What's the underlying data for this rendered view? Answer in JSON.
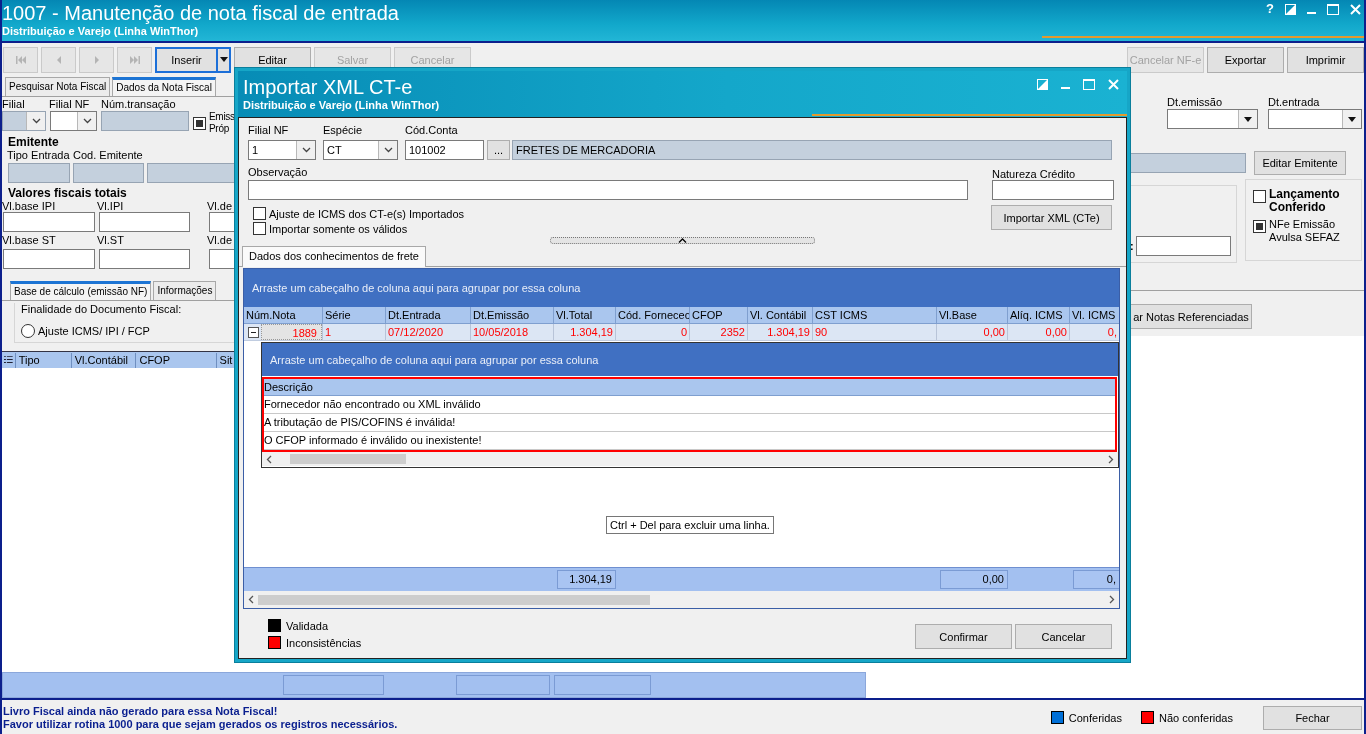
{
  "window": {
    "title": "1007 - Manutenção de nota fiscal de entrada",
    "subtitle": "Distribuição e Varejo (Linha WinThor)",
    "help": "?"
  },
  "toolbar": {
    "nav_buttons": [
      {
        "kind": "first",
        "disabled": true
      },
      {
        "kind": "prev",
        "disabled": true
      },
      {
        "kind": "next",
        "disabled": true
      },
      {
        "kind": "last",
        "disabled": true
      }
    ],
    "buttons": [
      {
        "label": "Inserir",
        "disabled": false,
        "focused": true,
        "dropdown": true
      },
      {
        "label": "Editar",
        "disabled": false,
        "focused": false,
        "dropdown": false
      },
      {
        "label": "Salvar",
        "disabled": true,
        "focused": false,
        "dropdown": false
      },
      {
        "label": "Cancelar",
        "disabled": true,
        "focused": false,
        "dropdown": false
      }
    ],
    "right_buttons": [
      {
        "label": "Cancelar NF-e",
        "disabled": true
      },
      {
        "label": "Exportar",
        "disabled": false
      },
      {
        "label": "Imprimir",
        "disabled": false
      }
    ]
  },
  "tabs": [
    {
      "label": "Pesquisar Nota Fiscal",
      "selected": false
    },
    {
      "label": "Dados da Nota Fiscal",
      "selected": true
    }
  ],
  "header": {
    "fields": [
      {
        "label": "Filial",
        "kind": "combo",
        "readonly": true
      },
      {
        "label": "Filial NF",
        "kind": "combo",
        "readonly": false
      },
      {
        "label": "Núm.transação",
        "kind": "text",
        "readonly": true
      }
    ],
    "checkbox": {
      "label": "Emiss Próp",
      "checked": true
    },
    "date_fields": [
      {
        "label": "Dt.emissão"
      },
      {
        "label": "Dt.entrada"
      }
    ]
  },
  "emitente": {
    "title": "Emitente",
    "fields": [
      {
        "label": "Tipo Entrada",
        "readonly": true
      },
      {
        "label": "Cod. Emitente",
        "readonly": true
      },
      {
        "readonly": true
      }
    ],
    "edit_button": "Editar Emitente"
  },
  "valores": {
    "title": "Valores fiscais totais",
    "rows": [
      [
        {
          "label": "Vl.base IPI"
        },
        {
          "label": "Vl.IPI"
        },
        {
          "label": "Vl.de"
        }
      ],
      [
        {
          "label": "Vl.base ST"
        },
        {
          "label": "Vl.ST"
        },
        {
          "label": "Vl.de"
        }
      ]
    ],
    "side_label": ":"
  },
  "flags": [
    {
      "label": "Lançamento Conferido",
      "checked": false,
      "bold": true
    },
    {
      "label": "NFe Emissão Avulsa SEFAZ",
      "checked": true,
      "bold": false
    }
  ],
  "lower_tabs": [
    {
      "label": "Base de cálculo (emissão NF)",
      "selected": true
    },
    {
      "label": "Informações",
      "selected": false
    }
  ],
  "finalidade": {
    "title": "Finalidade do Documento Fiscal:",
    "options": [
      {
        "label": "Ajuste ICMS/ IPI / FCP",
        "selected": false
      }
    ]
  },
  "referenced_button": "ar Notas Referenciadas",
  "items_grid": {
    "columns": [
      "Tipo",
      "Vl.Contábil",
      "CFOP",
      "Sit"
    ]
  },
  "status_bar": {
    "messages": [
      "Livro Fiscal ainda não gerado para essa Nota Fiscal!",
      "Favor utilizar rotina 1000 para que sejam gerados os registros necessários."
    ],
    "legend": [
      {
        "label": "Conferidas",
        "color": "#0070d8"
      },
      {
        "label": "Não conferidas",
        "color": "#ff0000"
      }
    ],
    "close_button": "Fechar"
  },
  "dialog": {
    "title": "Importar XML CT-e",
    "subtitle": "Distribuição e Varejo (Linha WinThor)",
    "filial_nf": {
      "label": "Filial NF",
      "value": "1"
    },
    "especie": {
      "label": "Espécie",
      "value": "CT"
    },
    "cod_conta": {
      "label": "Cód.Conta",
      "value": "101002",
      "lookup": "...",
      "description": "FRETES DE MERCADORIA"
    },
    "observacao": {
      "label": "Observação"
    },
    "natureza": {
      "label": "Natureza Crédito"
    },
    "options": [
      {
        "label": "Ajuste de ICMS dos CT-e(s) Importados",
        "checked": false
      },
      {
        "label": "Importar somente os válidos",
        "checked": false
      }
    ],
    "import_button": "Importar XML (CTe)",
    "tab": {
      "label": "Dados dos conhecimentos de frete",
      "selected": true
    },
    "grid": {
      "group_hint": "Arraste um cabeçalho de coluna aqui para agrupar por essa coluna",
      "columns": [
        {
          "label": "Núm.Nota",
          "kind": "number"
        },
        {
          "label": "Série",
          "kind": "text"
        },
        {
          "label": "Dt.Entrada",
          "kind": "text"
        },
        {
          "label": "Dt.Emissão",
          "kind": "text"
        },
        {
          "label": "Vl.Total",
          "kind": "number",
          "total": "1.304,19"
        },
        {
          "label": "Cód. Fornecec",
          "kind": "number"
        },
        {
          "label": "CFOP",
          "kind": "number"
        },
        {
          "label": "Vl. Contábil",
          "kind": "number"
        },
        {
          "label": "CST ICMS",
          "kind": "text"
        },
        {
          "label": "Vl.Base",
          "kind": "number",
          "total": "0,00"
        },
        {
          "label": "Alíq. ICMS",
          "kind": "number"
        },
        {
          "label": "Vl. ICMS",
          "kind": "number",
          "total": "0,"
        }
      ],
      "rows": [
        {
          "expanded": true,
          "inconsistent": true,
          "cells": [
            "1889",
            "1",
            "07/12/2020",
            "10/05/2018",
            "1.304,19",
            "0",
            "2352",
            "1.304,19",
            "90",
            "0,00",
            "0,00",
            "0,"
          ]
        }
      ],
      "detail": {
        "group_hint": "Arraste um cabeçalho de coluna aqui para agrupar por essa coluna",
        "column": "Descrição",
        "rows": [
          "Fornecedor não encontrado ou XML inválido",
          "A tributação de PIS/COFINS é inválida!",
          "O CFOP informado é inválido ou inexistente!"
        ]
      },
      "tooltip": "Ctrl + Del para excluir uma linha."
    },
    "legend": [
      {
        "label": "Validada",
        "color": "#000000"
      },
      {
        "label": "Inconsistências",
        "color": "#ff0000"
      }
    ],
    "buttons": [
      "Confirmar",
      "Cancelar"
    ]
  }
}
